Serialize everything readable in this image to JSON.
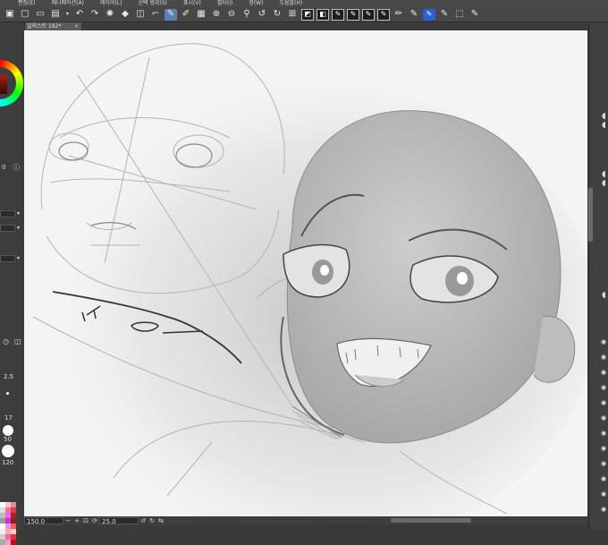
{
  "menu": {
    "items": [
      "편집(E)",
      "애니메이션(A)",
      "레이어(L)",
      "선택 범위(S)",
      "표시(V)",
      "필터(I)",
      "창(W)",
      "도움말(H)"
    ]
  },
  "toolbar": {
    "icons": [
      "window-icon",
      "new-file-icon",
      "open-folder-icon",
      "save-icon",
      "dropdown-icon",
      "undo-icon",
      "redo-icon",
      "loading-icon",
      "fill-icon",
      "transform-icon",
      "stabilizer-icon",
      "pen-icon",
      "pen-settings-icon",
      "copy-icon",
      "zoom-in-icon",
      "zoom-out-icon",
      "snap-icon",
      "rotate-left-icon",
      "rotate-right-icon",
      "snap-grid-icon",
      "flip-icon",
      "preset-1-icon",
      "preset-2-icon",
      "preset-3-icon",
      "preset-4-icon",
      "preset-5-icon",
      "preset-6-icon",
      "preset-7-icon"
    ]
  },
  "tabs": {
    "active_label": "일러스트 192*"
  },
  "left_panel": {
    "values": [
      "0",
      "2.5",
      "17",
      "50",
      "120"
    ],
    "readouts": [
      "2.5",
      "17",
      "50",
      "120"
    ],
    "palette": [
      "#ffffff",
      "#f4c9c9",
      "#e88",
      "#ddd",
      "#f6a",
      "#c44",
      "#bbb",
      "#e6e",
      "#a22",
      "#999",
      "#c3c",
      "#822",
      "#fff",
      "#d9d",
      "#f55",
      "#eee",
      "#faa",
      "#fcc",
      "#ccc",
      "#e6a",
      "#d33",
      "#aaa",
      "#f9c",
      "#b11"
    ]
  },
  "status": {
    "zoom": "150.0",
    "angle": "25.0"
  }
}
